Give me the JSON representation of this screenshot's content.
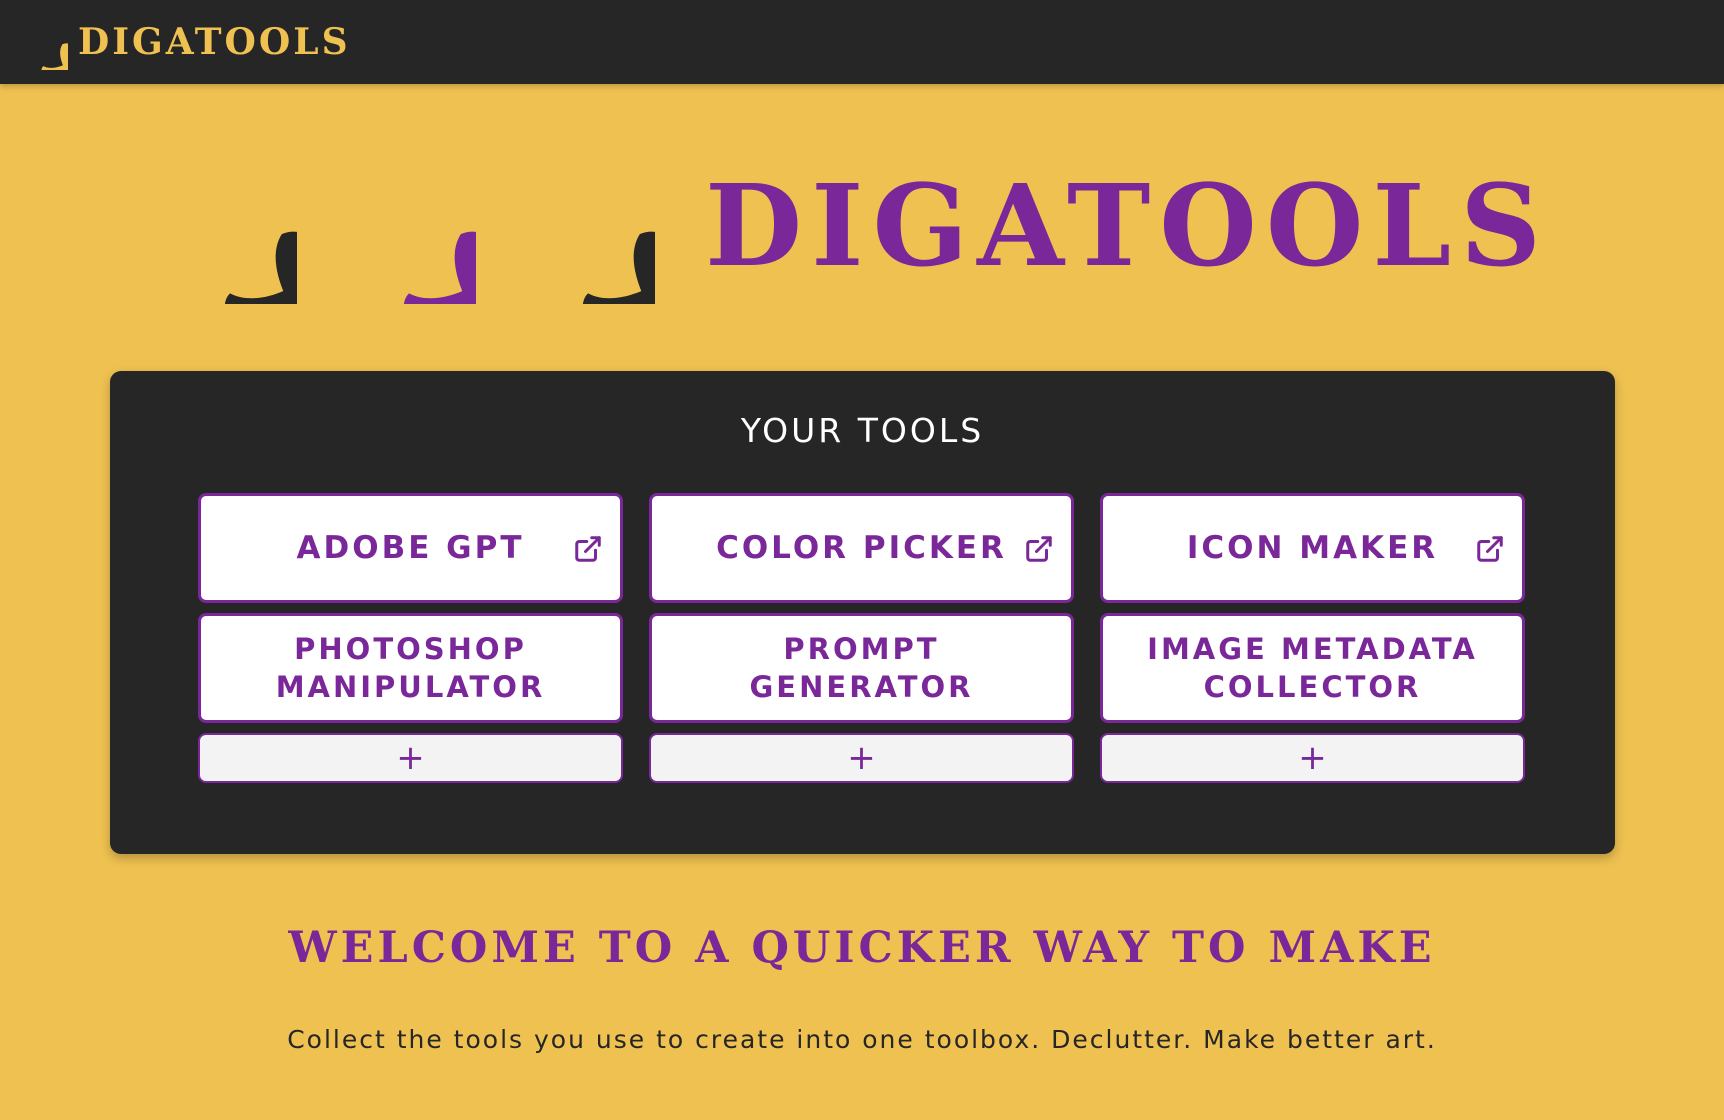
{
  "colors": {
    "background": "#efc151",
    "dark": "#262626",
    "brand_purple": "#7a2899",
    "brand_yellow": "#efc151",
    "card_white": "#ffffff",
    "add_card": "#f3f3f3"
  },
  "navbar": {
    "logo_icon": "pinwheel-logo-icon",
    "brand": "DIGATOOLS"
  },
  "hero": {
    "icons": [
      "pinwheel-icon",
      "pinwheel-icon",
      "pinwheel-icon"
    ],
    "title": "DIGATOOLS"
  },
  "tools": {
    "heading": "YOUR TOOLS",
    "items": [
      {
        "label": "ADOBE GPT",
        "external_link_icon": "external-link-icon"
      },
      {
        "label": "COLOR PICKER",
        "external_link_icon": "external-link-icon"
      },
      {
        "label": "ICON MAKER",
        "external_link_icon": "external-link-icon"
      },
      {
        "label": "PHOTOSHOP MANIPULATOR"
      },
      {
        "label": "PROMPT GENERATOR"
      },
      {
        "label": "IMAGE METADATA COLLECTOR"
      }
    ],
    "add_buttons": [
      "+",
      "+",
      "+"
    ]
  },
  "welcome": {
    "headline": "WELCOME TO A QUICKER WAY TO MAKE",
    "subtitle": "Collect the tools you use to create into one toolbox. Declutter. Make better art."
  }
}
